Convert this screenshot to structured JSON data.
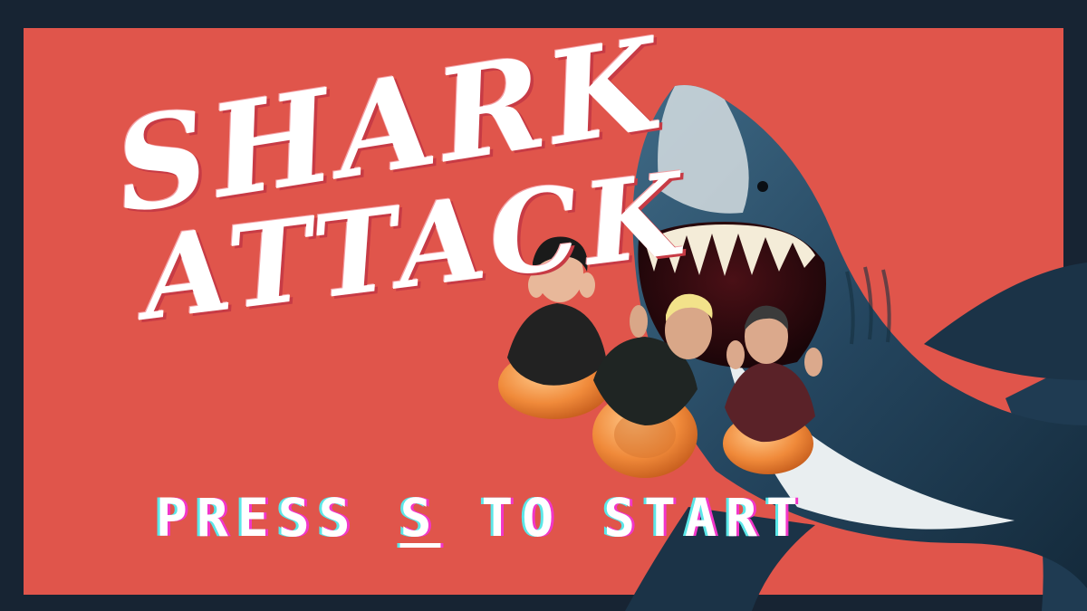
{
  "colors": {
    "frame": "#172433",
    "panel": "#e0554b",
    "shark_dark": "#24455e",
    "shark_light": "#e9eef0",
    "float_orange": "#f08a3a",
    "glitch_cyan": "#5be7e8",
    "glitch_magenta": "#f236c9"
  },
  "title": {
    "line1": "SHARK",
    "line2": "ATTACK"
  },
  "prompt": {
    "press": "PRESS ",
    "key": "S",
    "rest": " TO START"
  }
}
